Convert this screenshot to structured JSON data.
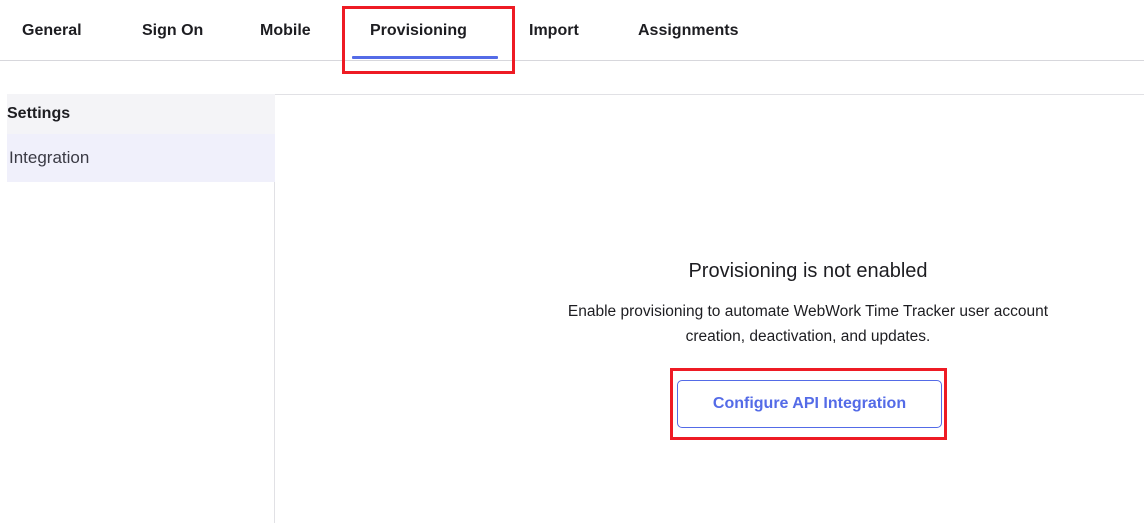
{
  "tabs": [
    {
      "label": "General"
    },
    {
      "label": "Sign On"
    },
    {
      "label": "Mobile"
    },
    {
      "label": "Provisioning",
      "active": true
    },
    {
      "label": "Import"
    },
    {
      "label": "Assignments"
    }
  ],
  "sidebar": {
    "heading": "Settings",
    "items": [
      {
        "label": "Integration",
        "selected": true
      }
    ]
  },
  "empty_state": {
    "title": "Provisioning is not enabled",
    "description_line1": "Enable provisioning to automate WebWork Time Tracker user account",
    "description_line2": "creation, deactivation, and updates.",
    "button_label": "Configure API Integration"
  },
  "colors": {
    "accent": "#546be7",
    "highlight": "#ee1b24"
  }
}
